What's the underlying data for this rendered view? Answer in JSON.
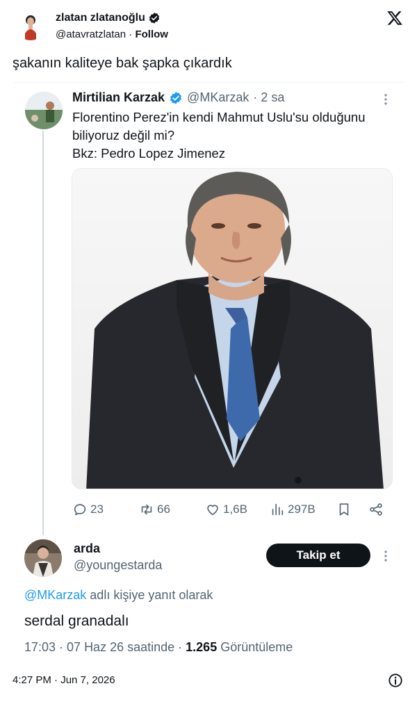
{
  "embed": {
    "author_name": "zlatan zlatanoğlu",
    "author_handle": "@atavratzlatan",
    "separator": "·",
    "follow_label": "Follow",
    "text": "şakanın kaliteye bak şapka çıkardık",
    "timestamp": "4:27 PM · Jun 7, 2026"
  },
  "quoted_tweet": {
    "author_name": "Mirtilian Karzak",
    "author_handle": "@MKarzak",
    "time": "· 2 sa",
    "text_lines": [
      "Florentino Perez'in kendi Mahmut Uslu'su olduğunu",
      "biliyoruz değil mi?",
      "Bkz: Pedro Lopez Jimenez"
    ],
    "actions": {
      "replies": "23",
      "retweets": "66",
      "likes": "1,6B",
      "views": "297B"
    }
  },
  "reply_tweet": {
    "author_name": "arda",
    "author_handle": "@youngestarda",
    "follow_label": "Takip et",
    "reply_mention": "@MKarzak",
    "reply_suffix": " adlı kişiye yanıt olarak",
    "text": "serdal granadalı",
    "meta_time": "17:03 · 07 Haz 26 saatinde · ",
    "meta_views": "1.265",
    "meta_views_label": " Görüntüleme"
  },
  "colors": {
    "verified": "#1d9bf0",
    "mention": "#1d9bf0",
    "muted": "#536471",
    "text": "#0f1419"
  }
}
